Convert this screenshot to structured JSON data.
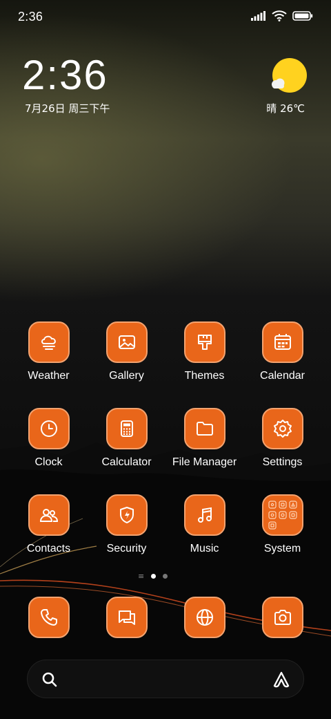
{
  "status_bar": {
    "time": "2:36"
  },
  "clock_widget": {
    "time": "2:36",
    "date": "7月26日 周三下午"
  },
  "weather_widget": {
    "condition_temp": "晴 26℃"
  },
  "apps": [
    {
      "label": "Weather",
      "icon": "weather-icon"
    },
    {
      "label": "Gallery",
      "icon": "gallery-icon"
    },
    {
      "label": "Themes",
      "icon": "themes-brush-icon"
    },
    {
      "label": "Calendar",
      "icon": "calendar-icon"
    },
    {
      "label": "Clock",
      "icon": "clock-icon"
    },
    {
      "label": "Calculator",
      "icon": "calculator-icon"
    },
    {
      "label": "File Manager",
      "icon": "folder-icon"
    },
    {
      "label": "Settings",
      "icon": "gear-icon"
    },
    {
      "label": "Contacts",
      "icon": "contacts-icon"
    },
    {
      "label": "Security",
      "icon": "shield-icon"
    },
    {
      "label": "Music",
      "icon": "music-note-icon"
    },
    {
      "label": "System",
      "icon": "folder-grid-icon"
    }
  ],
  "dock": [
    {
      "icon": "phone-icon"
    },
    {
      "icon": "messages-icon"
    },
    {
      "icon": "browser-globe-icon"
    },
    {
      "icon": "camera-icon"
    }
  ],
  "page_indicator": {
    "current": 2,
    "total": 2
  },
  "colors": {
    "app_orange": "#e9661a",
    "app_border": "#f4a36f",
    "sun_yellow": "#ffd21f"
  }
}
